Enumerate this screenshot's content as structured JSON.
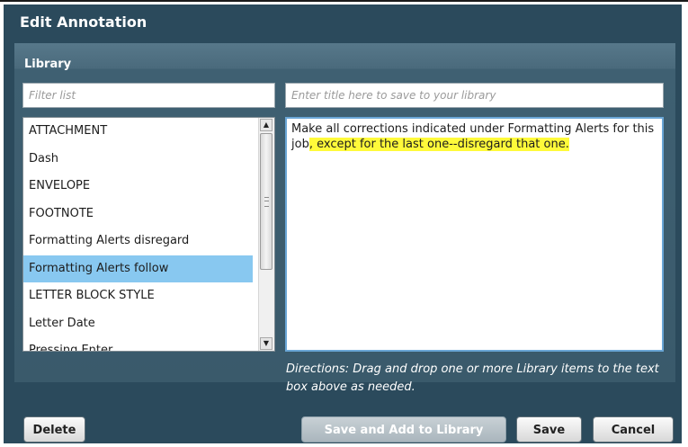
{
  "dialog": {
    "title": "Edit Annotation"
  },
  "library": {
    "label": "Library",
    "filter_placeholder": "Filter list",
    "title_placeholder": "Enter title here to save to your library",
    "items": [
      {
        "label": "ATTACHMENT"
      },
      {
        "label": "Dash"
      },
      {
        "label": "ENVELOPE"
      },
      {
        "label": "FOOTNOTE"
      },
      {
        "label": "Formatting Alerts disregard"
      },
      {
        "label": "Formatting Alerts follow",
        "selected": true
      },
      {
        "label": "LETTER BLOCK STYLE"
      },
      {
        "label": "Letter Date"
      },
      {
        "label": "Pressing Enter"
      }
    ],
    "selected_item": "Formatting Alerts follow"
  },
  "editor": {
    "text_plain": "Make all corrections indicated under Formatting Alerts for this job",
    "text_highlighted": ", except for the last one--disregard that one.",
    "highlight_color": "#fffa3a"
  },
  "directions": "Directions: Drag and drop one or more Library items to the text box above as needed.",
  "buttons": {
    "delete": "Delete",
    "save_and_add": "Save and Add to Library",
    "save": "Save",
    "cancel": "Cancel"
  },
  "colors": {
    "dialog_bg": "#2b4a5c",
    "selected_item": "#88c8f0",
    "text_box_border": "#6aa6d6"
  },
  "icons": {
    "scroll_up": "scroll-up-arrow-icon",
    "scroll_down": "scroll-down-arrow-icon"
  }
}
